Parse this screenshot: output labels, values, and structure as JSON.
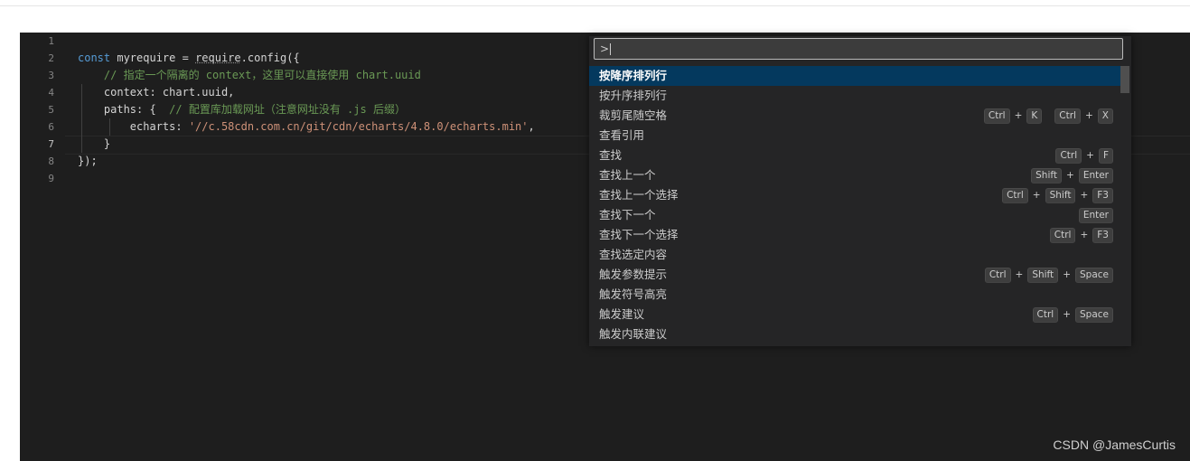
{
  "editor": {
    "line_numbers": [
      "1",
      "2",
      "3",
      "4",
      "5",
      "6",
      "7",
      "8",
      "9"
    ],
    "active_line": "7",
    "lines": [
      {
        "segments": []
      },
      {
        "segments": [
          {
            "cls": "kw",
            "text": "const "
          },
          {
            "cls": "txt",
            "text": "myrequire = "
          },
          {
            "cls": "txt squig",
            "text": "require"
          },
          {
            "cls": "txt",
            "text": ".config({"
          }
        ]
      },
      {
        "segments": [
          {
            "cls": "txt",
            "text": "    "
          },
          {
            "cls": "cm",
            "text": "// 指定一个隔离的 context，这里可以直接使用 chart.uuid"
          }
        ]
      },
      {
        "segments": [
          {
            "cls": "txt",
            "text": "    context: chart.uuid,"
          }
        ]
      },
      {
        "segments": [
          {
            "cls": "txt",
            "text": "    paths: {  "
          },
          {
            "cls": "cm",
            "text": "// 配置库加载网址（注意网址没有 .js 后缀）"
          }
        ]
      },
      {
        "segments": [
          {
            "cls": "txt",
            "text": "        echarts: "
          },
          {
            "cls": "str",
            "text": "'//c.58cdn.com.cn/git/cdn/echarts/4.8.0/echarts.min'"
          },
          {
            "cls": "txt",
            "text": ","
          }
        ]
      },
      {
        "segments": [
          {
            "cls": "txt",
            "text": "    }"
          }
        ]
      },
      {
        "segments": [
          {
            "cls": "txt",
            "text": "});"
          }
        ]
      },
      {
        "segments": []
      }
    ]
  },
  "palette": {
    "input_value": ">",
    "items": [
      {
        "label": "按降序排列行",
        "keys": []
      },
      {
        "label": "按升序排列行",
        "keys": []
      },
      {
        "label": "裁剪尾随空格",
        "keys": [
          [
            "Ctrl",
            "K"
          ],
          [
            "Ctrl",
            "X"
          ]
        ]
      },
      {
        "label": "查看引用",
        "keys": []
      },
      {
        "label": "查找",
        "keys": [
          [
            "Ctrl",
            "F"
          ]
        ]
      },
      {
        "label": "查找上一个",
        "keys": [
          [
            "Shift",
            "Enter"
          ]
        ]
      },
      {
        "label": "查找上一个选择",
        "keys": [
          [
            "Ctrl",
            "Shift",
            "F3"
          ]
        ]
      },
      {
        "label": "查找下一个",
        "keys": [
          [
            "Enter"
          ]
        ]
      },
      {
        "label": "查找下一个选择",
        "keys": [
          [
            "Ctrl",
            "F3"
          ]
        ]
      },
      {
        "label": "查找选定内容",
        "keys": []
      },
      {
        "label": "触发参数提示",
        "keys": [
          [
            "Ctrl",
            "Shift",
            "Space"
          ]
        ]
      },
      {
        "label": "触发符号高亮",
        "keys": []
      },
      {
        "label": "触发建议",
        "keys": [
          [
            "Ctrl",
            "Space"
          ]
        ]
      },
      {
        "label": "触发内联建议",
        "keys": []
      }
    ],
    "selected_index": 0
  },
  "watermark": "CSDN @JamesCurtis",
  "colors": {
    "editor_bg": "#1e1e1e",
    "palette_bg": "#252526",
    "selected_row": "#04395e",
    "keyword": "#569cd6",
    "comment": "#6a9955",
    "string": "#ce9178"
  }
}
